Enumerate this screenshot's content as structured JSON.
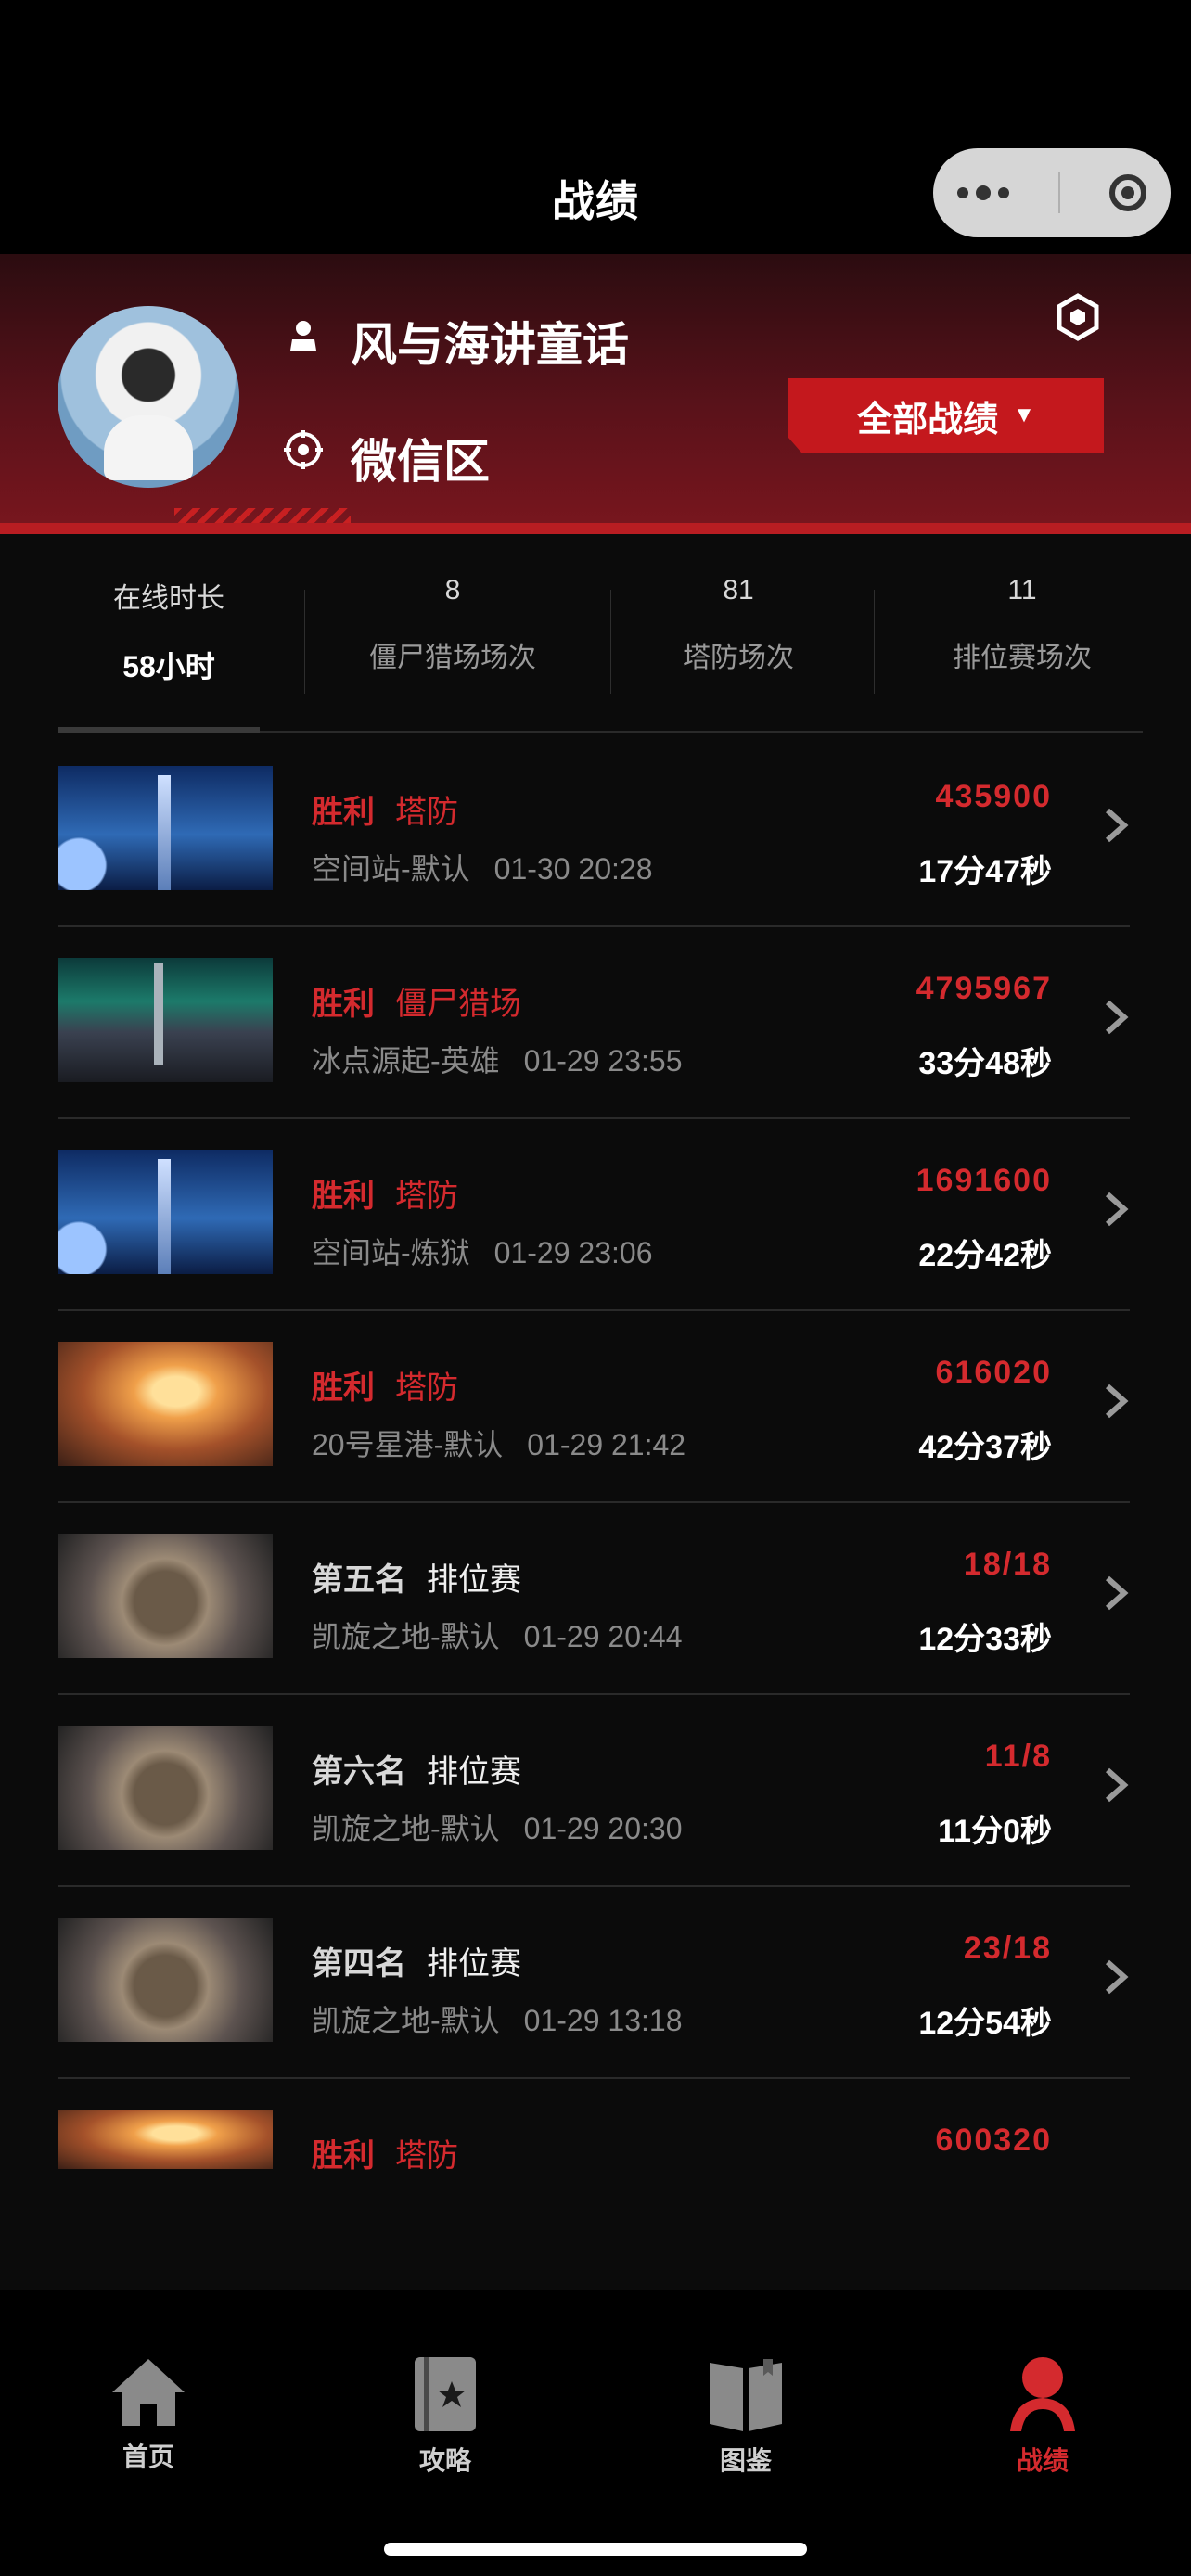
{
  "header": {
    "title": "战绩"
  },
  "profile": {
    "name": "风与海讲童话",
    "server": "微信区",
    "all_records_label": "全部战绩"
  },
  "stats": [
    {
      "top": "在线时长",
      "bottom": "58小时"
    },
    {
      "top": "8",
      "bottom": "僵尸猎场场次"
    },
    {
      "top": "81",
      "bottom": "塔防场次"
    },
    {
      "top": "11",
      "bottom": "排位赛场次"
    }
  ],
  "records": [
    {
      "result": "胜利",
      "mode": "塔防",
      "map": "空间站-默认",
      "time": "01-30 20:28",
      "score": "435900",
      "duration": "17分47秒"
    },
    {
      "result": "胜利",
      "mode": "僵尸猎场",
      "map": "冰点源起-英雄",
      "time": "01-29 23:55",
      "score": "4795967",
      "duration": "33分48秒"
    },
    {
      "result": "胜利",
      "mode": "塔防",
      "map": "空间站-炼狱",
      "time": "01-29 23:06",
      "score": "1691600",
      "duration": "22分42秒"
    },
    {
      "result": "胜利",
      "mode": "塔防",
      "map": "20号星港-默认",
      "time": "01-29 21:42",
      "score": "616020",
      "duration": "42分37秒"
    },
    {
      "result": "第五名",
      "mode": "排位赛",
      "map": "凯旋之地-默认",
      "time": "01-29 20:44",
      "score": "18/18",
      "duration": "12分33秒"
    },
    {
      "result": "第六名",
      "mode": "排位赛",
      "map": "凯旋之地-默认",
      "time": "01-29 20:30",
      "score": "11/8",
      "duration": "11分0秒"
    },
    {
      "result": "第四名",
      "mode": "排位赛",
      "map": "凯旋之地-默认",
      "time": "01-29 13:18",
      "score": "23/18",
      "duration": "12分54秒"
    },
    {
      "result": "胜利",
      "mode": "塔防",
      "map": "",
      "time": "",
      "score": "600320",
      "duration": ""
    }
  ],
  "tabbar": [
    {
      "label": "首页",
      "icon": "home-icon"
    },
    {
      "label": "攻略",
      "icon": "guide-book-icon"
    },
    {
      "label": "图鉴",
      "icon": "open-book-icon"
    },
    {
      "label": "战绩",
      "icon": "profile-icon"
    }
  ],
  "colors": {
    "accent": "#d42a2e",
    "banner": "#7a161e"
  }
}
